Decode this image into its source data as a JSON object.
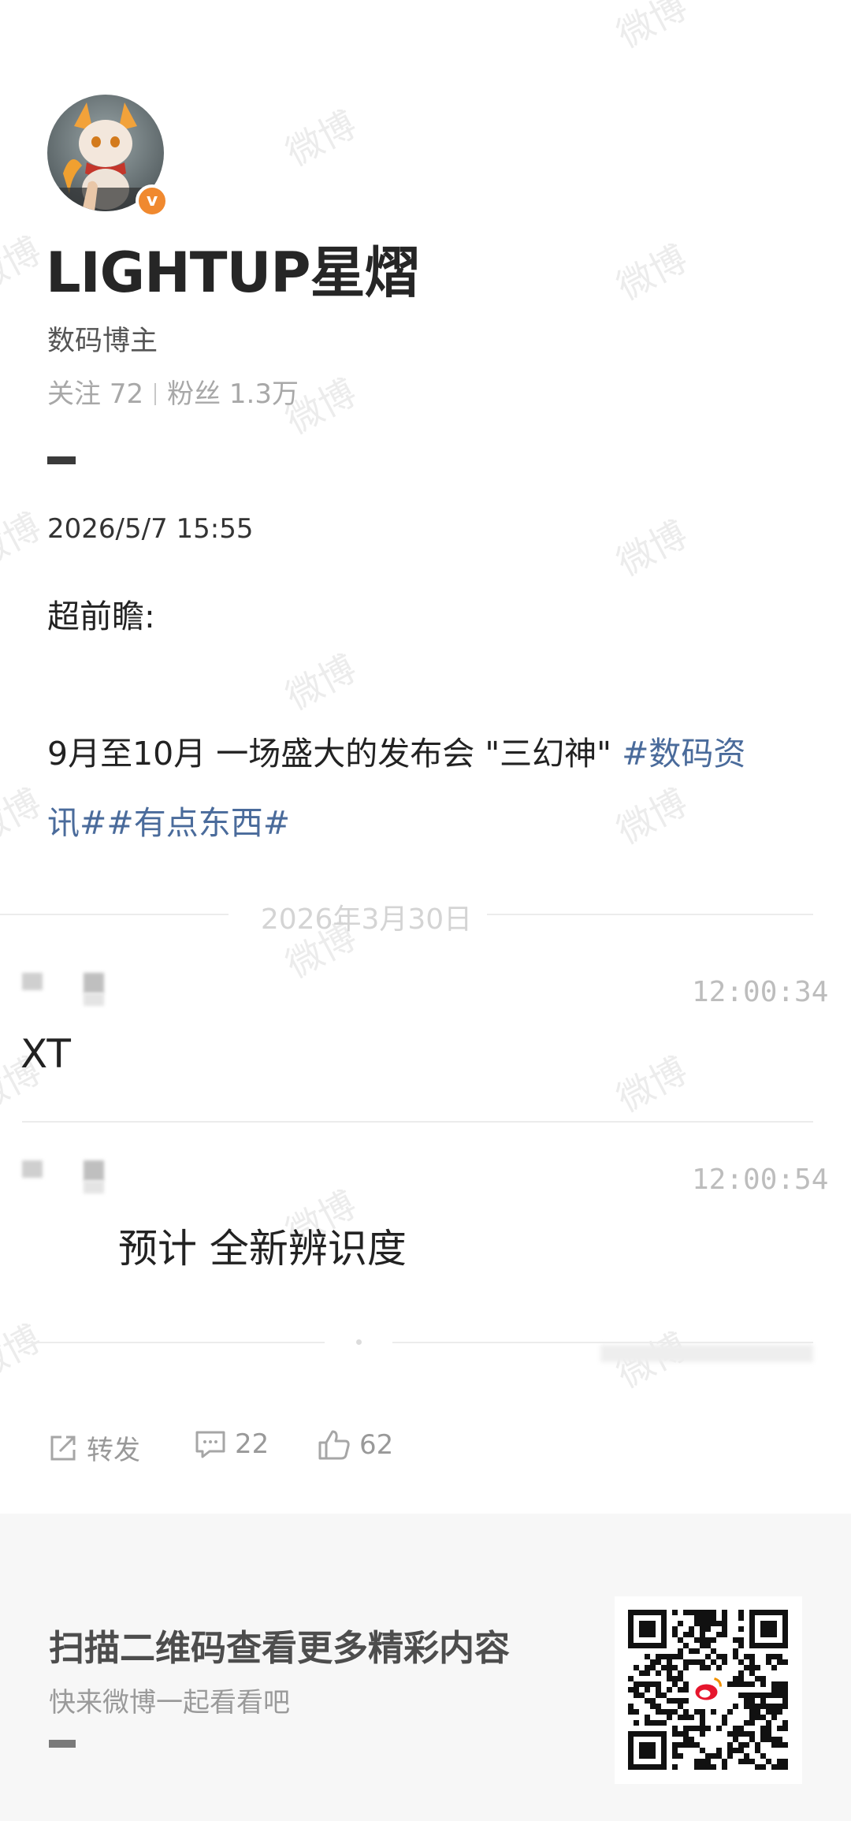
{
  "watermark": "微博",
  "profile": {
    "name": "LIGHTUP星熠",
    "role": "数码博主",
    "follow_label": "关注",
    "follow_count": "72",
    "fans_label": "粉丝",
    "fans_count": "1.3万"
  },
  "post": {
    "datetime": "2026/5/7 15:55",
    "line1": "超前瞻:",
    "line2_text": "9月至10月 一场盛大的发布会 \"三幻神\" ",
    "line2_tag": "#数码资",
    "line3_tag": "讯##有点东西#"
  },
  "chat": {
    "date": "2026年3月30日",
    "messages": [
      {
        "time": "12:00:34",
        "text": "XT"
      },
      {
        "time": "12:00:54",
        "text": "预计 全新辨识度"
      }
    ]
  },
  "actions": {
    "repost_label": "转发",
    "comment_count": "22",
    "like_count": "62"
  },
  "footer": {
    "title": "扫描二维码查看更多精彩内容",
    "subtitle": "快来微博一起看看吧"
  },
  "colors": {
    "tag": "#4a6b9b",
    "badge": "#f0892f",
    "footer_bg": "#f7f7f7"
  }
}
